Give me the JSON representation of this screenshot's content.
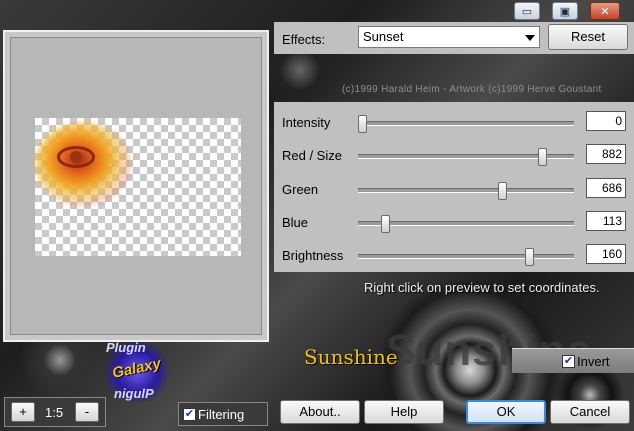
{
  "window": {
    "minimize_label": "▭",
    "maximize_label": "▣",
    "close_label": "✕"
  },
  "effects": {
    "label": "Effects:",
    "selected": "Sunset",
    "reset_label": "Reset"
  },
  "copyright": "(c)1999 Harald Heim - Artwork (c)1999 Herve Goustant",
  "sliders": [
    {
      "label": "Intensity",
      "value": "0",
      "fraction": 0.0
    },
    {
      "label": "Red / Size",
      "value": "882",
      "fraction": 0.862
    },
    {
      "label": "Green",
      "value": "686",
      "fraction": 0.67
    },
    {
      "label": "Blue",
      "value": "113",
      "fraction": 0.11
    },
    {
      "label": "Brightness",
      "value": "160",
      "fraction": 0.8
    }
  ],
  "hint": "Right click on preview to set coordinates.",
  "logo_text": {
    "plugin": "Plugin",
    "galaxy": "Galaxy",
    "plugin_mirror": "nigulP",
    "filter_name": "Sunshine",
    "filter_name_ghost": "Sunshine"
  },
  "invert": {
    "label": "Invert",
    "checked": true
  },
  "filtering": {
    "label": "Filtering",
    "checked": true
  },
  "zoom": {
    "plus": "+",
    "level": "1:5",
    "minus": "-"
  },
  "buttons": {
    "about": "About..",
    "help": "Help",
    "ok": "OK",
    "cancel": "Cancel"
  }
}
